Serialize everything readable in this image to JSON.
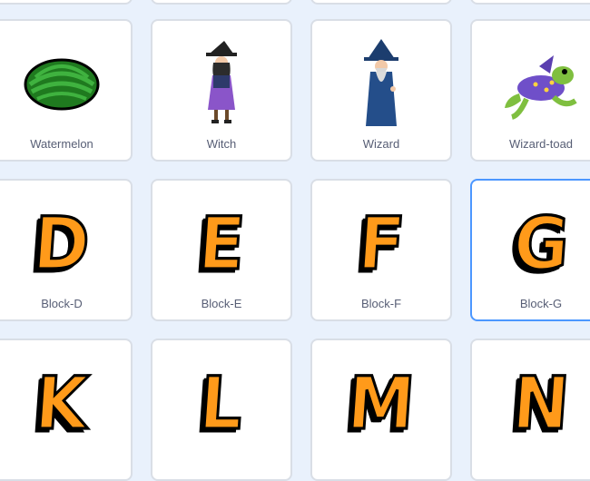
{
  "sprites_row1": [
    {
      "name": "Watermelon",
      "icon": "watermelon-icon"
    },
    {
      "name": "Witch",
      "icon": "witch-icon"
    },
    {
      "name": "Wizard",
      "icon": "wizard-icon"
    },
    {
      "name": "Wizard-toad",
      "icon": "wizard-toad-icon"
    }
  ],
  "sprites_row2": [
    {
      "name": "Block-D",
      "glyph": "D"
    },
    {
      "name": "Block-E",
      "glyph": "E"
    },
    {
      "name": "Block-F",
      "glyph": "F"
    },
    {
      "name": "Block-G",
      "glyph": "G"
    }
  ],
  "sprites_row3": [
    {
      "glyph": "K"
    },
    {
      "glyph": "L"
    },
    {
      "glyph": "M"
    },
    {
      "glyph": "N"
    }
  ],
  "colors": {
    "background": "#e9f1fc",
    "tile_border": "#d9dee6",
    "selected_border": "#4c97ff",
    "letter_fill": "#ff9a1a",
    "label_text": "#575e75"
  }
}
